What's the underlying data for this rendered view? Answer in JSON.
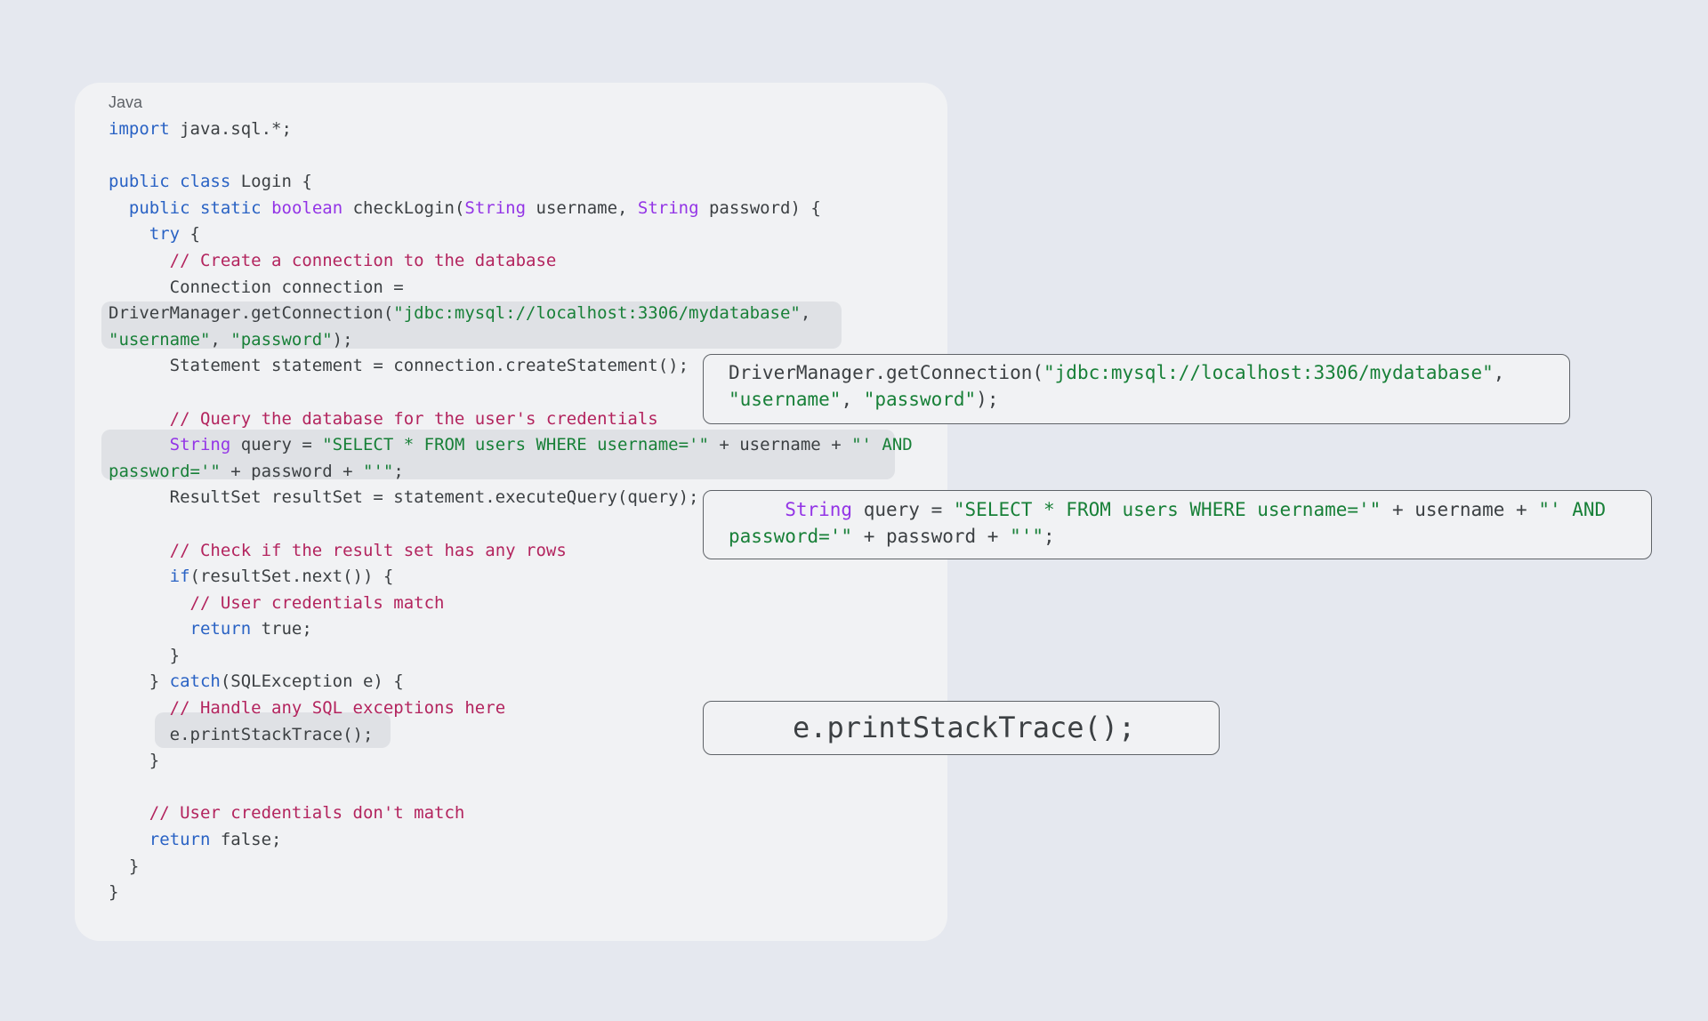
{
  "code_block": {
    "language": "Java",
    "lines": [
      [
        [
          "kw",
          "import"
        ],
        [
          "p",
          " java.sql.*;"
        ]
      ],
      [],
      [
        [
          "kw",
          "public class"
        ],
        [
          "p",
          " Login {"
        ]
      ],
      [
        [
          "p",
          "  "
        ],
        [
          "kw",
          "public static"
        ],
        [
          "p",
          " "
        ],
        [
          "ty",
          "boolean"
        ],
        [
          "p",
          " checkLogin("
        ],
        [
          "ty",
          "String"
        ],
        [
          "p",
          " username, "
        ],
        [
          "ty",
          "String"
        ],
        [
          "p",
          " password) {"
        ]
      ],
      [
        [
          "p",
          "    "
        ],
        [
          "kw",
          "try"
        ],
        [
          "p",
          " {"
        ]
      ],
      [
        [
          "p",
          "      "
        ],
        [
          "cm",
          "// Create a connection to the database"
        ]
      ],
      [
        [
          "p",
          "      Connection connection ="
        ]
      ],
      [
        [
          "p",
          "DriverManager.getConnection("
        ],
        [
          "str",
          "\"jdbc:mysql://localhost:3306/mydatabase\""
        ],
        [
          "p",
          ","
        ]
      ],
      [
        [
          "str",
          "\"username\""
        ],
        [
          "p",
          ", "
        ],
        [
          "str",
          "\"password\""
        ],
        [
          "p",
          ");"
        ]
      ],
      [
        [
          "p",
          "      Statement statement = connection.createStatement();"
        ]
      ],
      [],
      [
        [
          "p",
          "      "
        ],
        [
          "cm",
          "// Query the database for the user's credentials"
        ]
      ],
      [
        [
          "p",
          "      "
        ],
        [
          "ty",
          "String"
        ],
        [
          "p",
          " query = "
        ],
        [
          "str",
          "\"SELECT * FROM users WHERE username='\""
        ],
        [
          "p",
          " + username + "
        ],
        [
          "str",
          "\"' AND"
        ]
      ],
      [
        [
          "str",
          "password='\""
        ],
        [
          "p",
          " + password + "
        ],
        [
          "str",
          "\"'\""
        ],
        [
          "p",
          ";"
        ]
      ],
      [
        [
          "p",
          "      ResultSet resultSet = statement.executeQuery(query);"
        ]
      ],
      [],
      [
        [
          "p",
          "      "
        ],
        [
          "cm",
          "// Check if the result set has any rows"
        ]
      ],
      [
        [
          "p",
          "      "
        ],
        [
          "kw",
          "if"
        ],
        [
          "p",
          "(resultSet.next()) {"
        ]
      ],
      [
        [
          "p",
          "        "
        ],
        [
          "cm",
          "// User credentials match"
        ]
      ],
      [
        [
          "p",
          "        "
        ],
        [
          "kw",
          "return"
        ],
        [
          "p",
          " true;"
        ]
      ],
      [
        [
          "p",
          "      }"
        ]
      ],
      [
        [
          "p",
          "    } "
        ],
        [
          "kw",
          "catch"
        ],
        [
          "p",
          "(SQLException e) {"
        ]
      ],
      [
        [
          "p",
          "      "
        ],
        [
          "cm",
          "// Handle any SQL exceptions here"
        ]
      ],
      [
        [
          "p",
          "      e.printStackTrace();"
        ]
      ],
      [
        [
          "p",
          "    }"
        ]
      ],
      [],
      [
        [
          "p",
          "    "
        ],
        [
          "cm",
          "// User credentials don't match"
        ]
      ],
      [
        [
          "p",
          "    "
        ],
        [
          "kw",
          "return"
        ],
        [
          "p",
          " false;"
        ]
      ],
      [
        [
          "p",
          "  }"
        ]
      ],
      [
        [
          "p",
          "}"
        ]
      ]
    ]
  },
  "callouts": {
    "connection": [
      [
        [
          "p",
          "DriverManager.getConnection("
        ],
        [
          "str",
          "\"jdbc:mysql://localhost:3306/mydatabase\""
        ],
        [
          "p",
          ","
        ]
      ],
      [
        [
          "str",
          "\"username\""
        ],
        [
          "p",
          ", "
        ],
        [
          "str",
          "\"password\""
        ],
        [
          "p",
          ");"
        ]
      ]
    ],
    "query": [
      [
        [
          "p",
          "     "
        ],
        [
          "ty",
          "String"
        ],
        [
          "p",
          " query = "
        ],
        [
          "str",
          "\"SELECT * FROM users WHERE username='\""
        ],
        [
          "p",
          " + username + "
        ],
        [
          "str",
          "\"' AND"
        ]
      ],
      [
        [
          "str",
          "password='\""
        ],
        [
          "p",
          " + password + "
        ],
        [
          "str",
          "\"'\""
        ],
        [
          "p",
          ";"
        ]
      ]
    ],
    "trace": [
      [
        [
          "p",
          "e.printStackTrace();"
        ]
      ]
    ]
  },
  "colors": {
    "background": "#e5e8ef",
    "card": "#f1f2f4",
    "highlight": "#dfe1e5",
    "keyword": "#2962c4",
    "type": "#9334e6",
    "string": "#188038",
    "comment": "#b3245e",
    "plain": "#3c4043"
  }
}
